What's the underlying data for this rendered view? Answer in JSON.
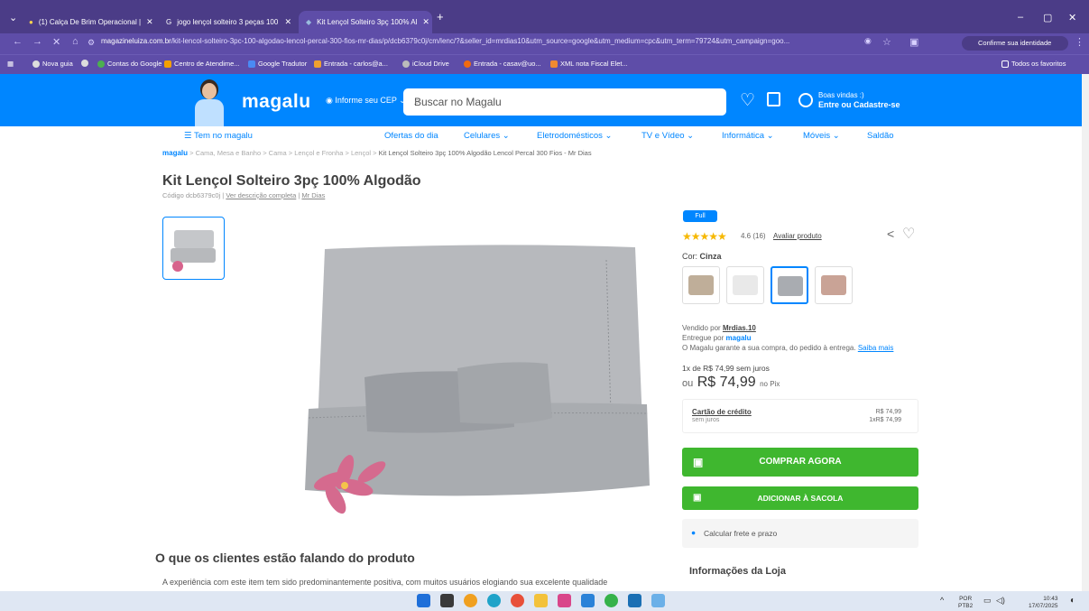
{
  "browser": {
    "tabs": [
      {
        "label": "(1) Calça De Brim Operacional |"
      },
      {
        "label": "jogo lençol solteiro 3 peças 100"
      },
      {
        "label": "Kit Lençol Solteiro 3pç 100% Al"
      }
    ],
    "url_domain": "magazineluiza.com.br",
    "url_path": "/kit-lencol-solteiro-3pc-100-algodao-lencol-percal-300-fios-mr-dias/p/dcb6379c0j/cm/lenc/?&seller_id=mrdias10&utm_source=google&utm_medium=cpc&utm_term=79724&utm_campaign=goo...",
    "profile_label": "Confirme sua identidade",
    "bookmarks": [
      "Nova guia",
      "Contas do Google",
      "Centro de Atendime...",
      "Google Tradutor",
      "Entrada - carlos@a...",
      "iCloud Drive",
      "Entrada - casav@uo...",
      "XML nota Fiscal Elet..."
    ],
    "all_bookmarks": "Todos os favoritos"
  },
  "header": {
    "logo": "magalu",
    "cep": "Informe seu CEP",
    "search_placeholder": "Buscar no Magalu",
    "welcome_line1": "Boas vindas :)",
    "welcome_line2": "Entre ou Cadastre-se"
  },
  "nav": [
    "Tem no magalu",
    "Ofertas do dia",
    "Celulares",
    "Eletrodomésticos",
    "TV e Vídeo",
    "Informática",
    "Móveis",
    "Saldão"
  ],
  "breadcrumb": {
    "logo": "magalu",
    "path": "> Cama, Mesa e Banho > Cama > Lençol e Fronha > Lençol >",
    "current": "Kit Lençol Solteiro 3pç 100% Algodão Lencol Percal 300 Fios - Mr Dias"
  },
  "product": {
    "title": "Kit Lençol Solteiro 3pç 100% Algodão",
    "code": "Código dcb6379c0j |",
    "desc_link": "Ver descrição completa",
    "brand": "Mr Dias",
    "full_badge": "Full",
    "stars": "★★★★★",
    "rating": "4.6 (16)",
    "rate_link": "Avaliar produto",
    "color_label": "Cor:",
    "color_value": "Cinza",
    "swatches": [
      "#bfae99",
      "#e9e9e9",
      "#a9acb1",
      "#c9a396"
    ],
    "selected_swatch": 2,
    "sold_by": "Vendido por",
    "seller": "Mrdias.10",
    "delivered_by": "Entregue por",
    "delivered_logo": "magalu",
    "guarantee": "O Magalu garante a sua compra, do pedido à entrega.",
    "know_more": "Saiba mais",
    "installment": "1x de R$ 74,99 sem juros",
    "price_prefix": "ou",
    "price": "R$ 74,99",
    "price_suffix": "no Pix",
    "card_label": "Cartão de crédito",
    "card_sub": "sem juros",
    "card_price": "R$ 74,99",
    "card_install": "1xR$ 74,99",
    "buy_now": "COMPRAR AGORA",
    "add_bag": "ADICIONAR À SACOLA",
    "shipping": "Calcular frete e prazo",
    "store_info": "Informações da Loja"
  },
  "reviews": {
    "heading": "O que os clientes estão falando do produto",
    "text": "A experiência com este item tem sido predominantemente positiva, com muitos usuários elogiando sua excelente qualidade"
  },
  "taskbar": {
    "lang1": "POR",
    "lang2": "PTB2",
    "time": "10:43",
    "date": "17/07/2025"
  }
}
